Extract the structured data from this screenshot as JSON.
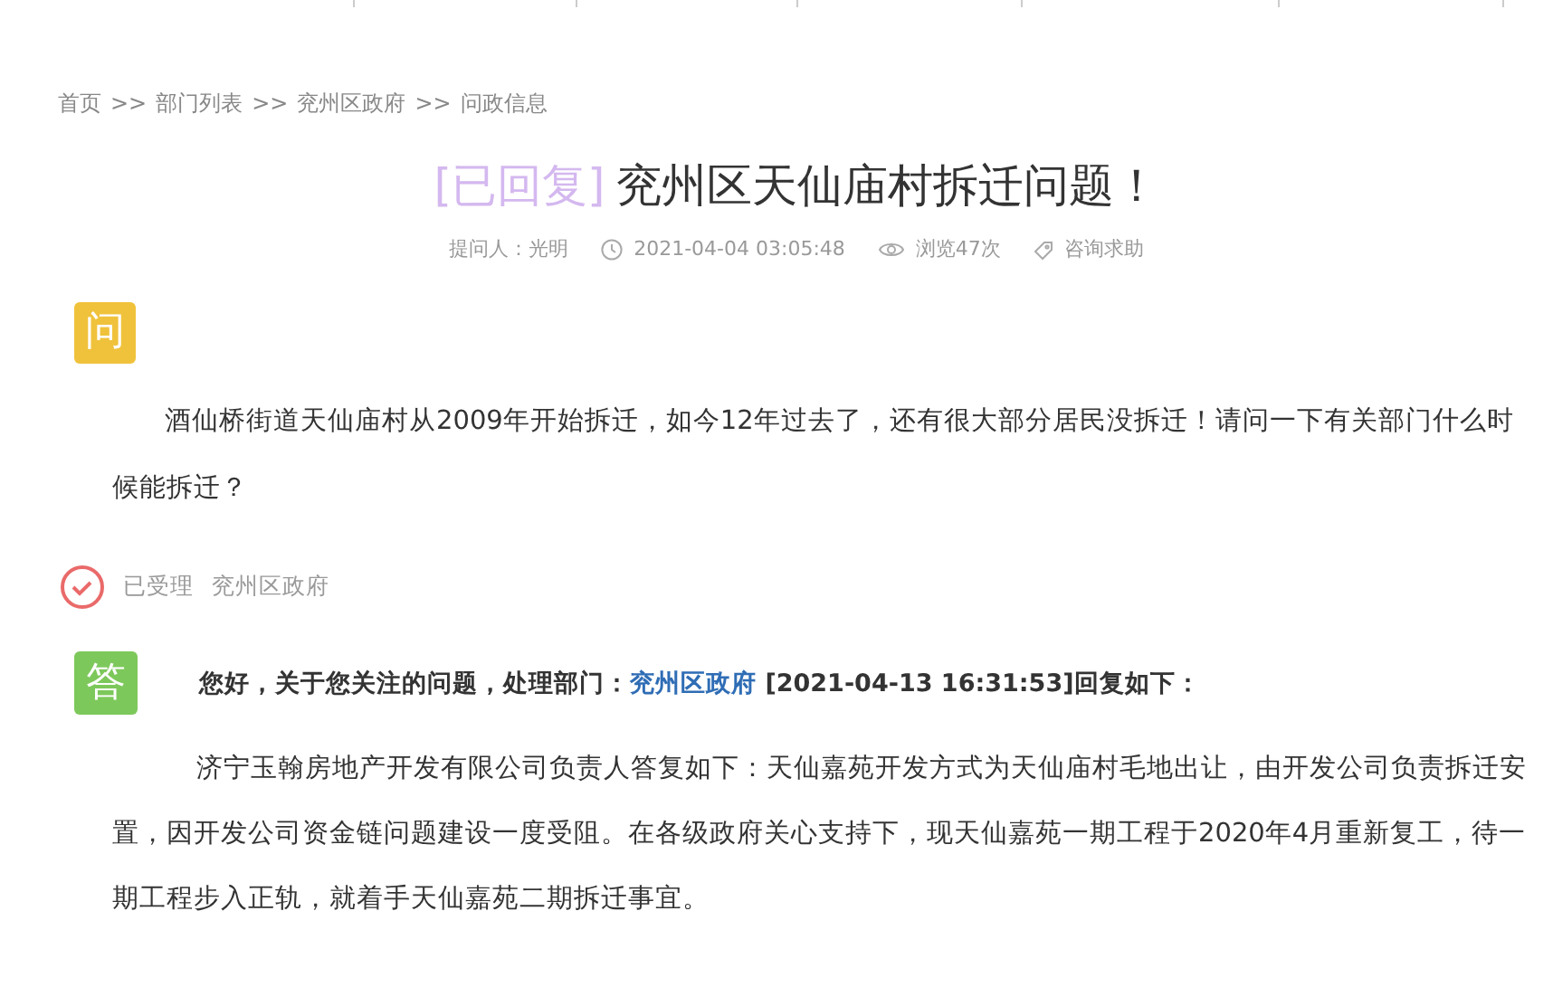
{
  "breadcrumb": {
    "items": [
      "首页",
      "部门列表",
      "兖州区政府",
      "问政信息"
    ],
    "separator": ">>"
  },
  "title": {
    "status": "[已回复]",
    "text": "兖州区天仙庙村拆迁问题！"
  },
  "meta": {
    "asker": "提问人：光明",
    "time": "2021-04-04 03:05:48",
    "views": "浏览47次",
    "category": "咨询求助"
  },
  "question": {
    "badge": "问",
    "text": "酒仙桥街道天仙庙村从2009年开始拆迁，如今12年过去了，还有很大部分居民没拆迁！请问一下有关部门什么时候能拆迁？"
  },
  "status_row": {
    "state": "已受理",
    "department": "兖州区政府"
  },
  "answer": {
    "badge": "答",
    "intro": "您好，关于您关注的问题，处理部门：",
    "department": "兖州区政府",
    "time_suffix": "[2021-04-13 16:31:53]回复如下：",
    "text": "济宁玉翰房地产开发有限公司负责人答复如下：天仙嘉苑开发方式为天仙庙村毛地出让，由开发公司负责拆迁安置，因开发公司资金链问题建设一度受阻。在各级政府关心支持下，现天仙嘉苑一期工程于2020年4月重新复工，待一期工程步入正轨，就着手天仙嘉苑二期拆迁事宜。"
  }
}
